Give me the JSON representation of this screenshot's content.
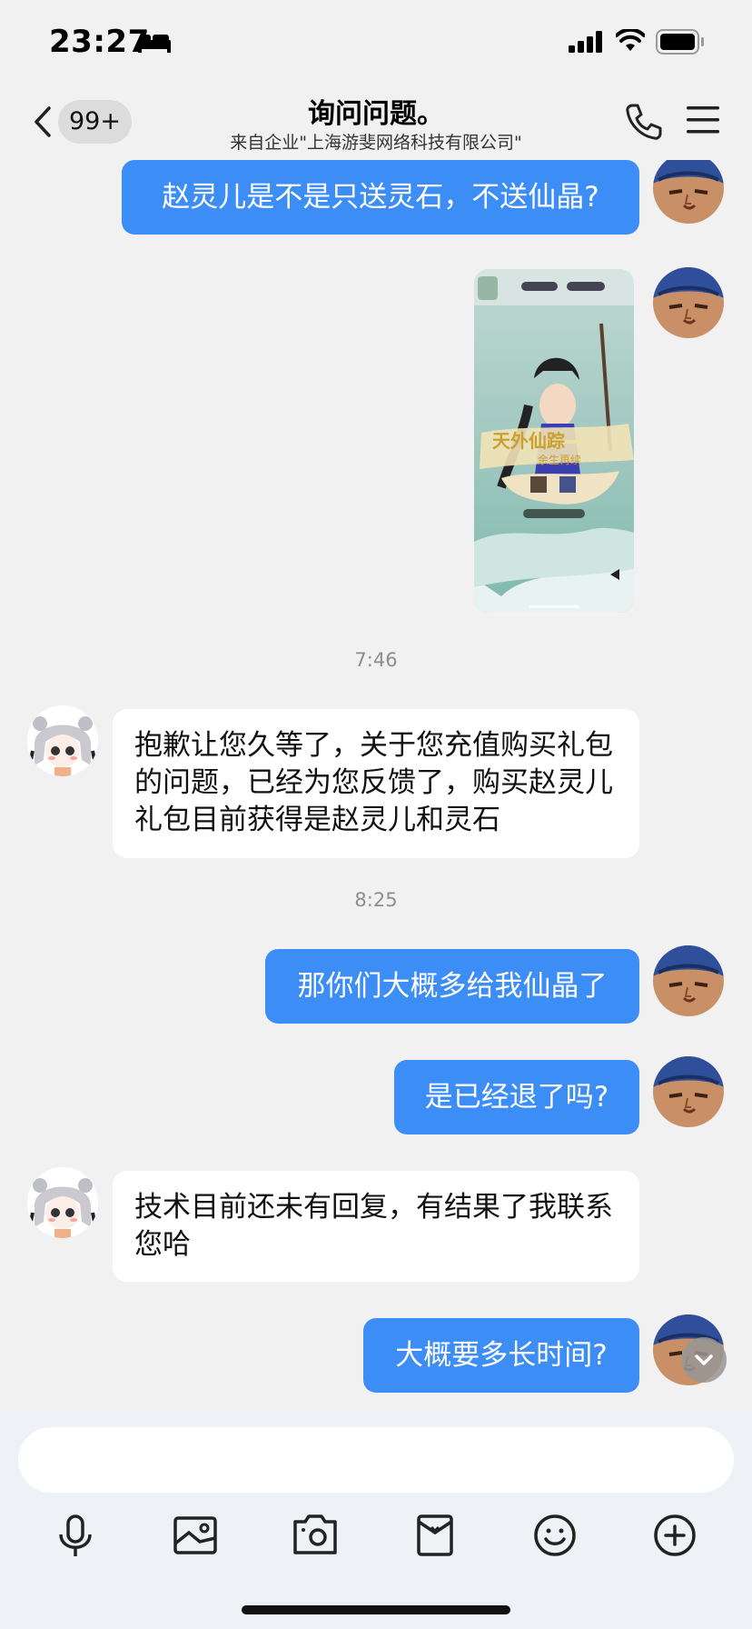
{
  "status_bar": {
    "time": "23:27"
  },
  "header": {
    "unread_badge": "99+",
    "title": "询问问题。",
    "subtitle": "来自企业\"上海游斐网络科技有限公司\""
  },
  "messages": {
    "m1": "赵灵儿是不是只送灵石，不送仙晶?",
    "ts1": "7:46",
    "m2": "抱歉让您久等了，关于您充值购买礼包的问题，已经为您反馈了，购买赵灵儿礼包目前获得是赵灵儿和灵石",
    "ts2": "8:25",
    "m3": "那你们大概多给我仙晶了",
    "m4": "是已经退了吗?",
    "m5": "技术目前还未有回复，有结果了我联系您哈",
    "m6": "大概要多长时间?"
  },
  "image_message": {
    "banner_text": "天外仙踪停仙灵",
    "banner_sub": "余生再续未了缘"
  },
  "input": {
    "placeholder": ""
  },
  "icons": {
    "back": "chevron-left-icon",
    "phone": "phone-icon",
    "menu": "menu-icon",
    "voice": "microphone-icon",
    "image": "image-icon",
    "camera": "camera-icon",
    "red_packet": "red-packet-icon",
    "emoji": "emoji-icon",
    "plus": "plus-icon",
    "scroll": "chevron-down-icon"
  },
  "colors": {
    "bubble_self": "#3d8df7",
    "bubble_other": "#ffffff",
    "background": "#f1f1f1"
  }
}
